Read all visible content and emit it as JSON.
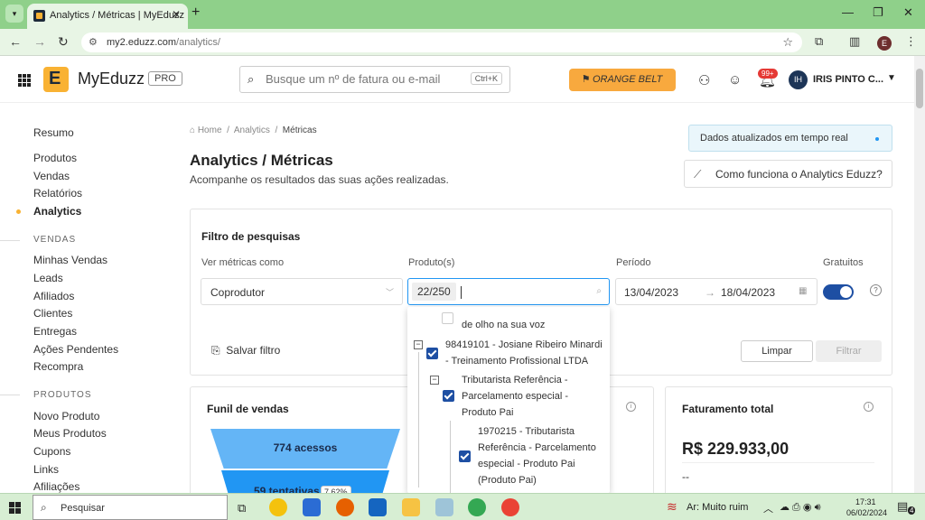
{
  "browser": {
    "tab_title": "Analytics / Métricas | MyEduzz",
    "url_host": "my2.eduzz.com",
    "url_path": "/analytics/",
    "profile_letter": "E"
  },
  "header": {
    "brand": "MyEduzz",
    "plan": "PRO",
    "search_placeholder": "Busque um nº de fatura ou e-mail",
    "search_shortcut": "Ctrl+K",
    "belt_label": "ORANGE BELT",
    "notif_count": "99+",
    "user_initials": "IH",
    "user_name": "IRIS PINTO C..."
  },
  "sidebar": {
    "top_items": [
      {
        "label": "Resumo"
      },
      {
        "label": "Produtos"
      },
      {
        "label": "Vendas"
      },
      {
        "label": "Relatórios"
      },
      {
        "label": "Analytics"
      }
    ],
    "sales_title": "VENDAS",
    "sales_items": [
      {
        "label": "Minhas Vendas"
      },
      {
        "label": "Leads"
      },
      {
        "label": "Afiliados"
      },
      {
        "label": "Clientes"
      },
      {
        "label": "Entregas"
      },
      {
        "label": "Ações Pendentes"
      },
      {
        "label": "Recompra"
      }
    ],
    "products_title": "PRODUTOS",
    "products_items": [
      {
        "label": "Novo Produto"
      },
      {
        "label": "Meus Produtos"
      },
      {
        "label": "Cupons"
      },
      {
        "label": "Links"
      },
      {
        "label": "Afiliações"
      }
    ]
  },
  "main": {
    "breadcrumb": {
      "home": "Home",
      "sep": "/",
      "analytics": "Analytics",
      "current": "Métricas"
    },
    "title": "Analytics / Métricas",
    "subtitle": "Acompanhe os resultados das suas ações realizadas.",
    "realtime": "Dados atualizados em tempo real",
    "howto": "Como funciona o Analytics Eduzz?",
    "filter": {
      "title": "Filtro de pesquisas",
      "view_label": "Ver métricas como",
      "view_value": "Coprodutor",
      "product_label": "Produto(s)",
      "product_count": "22/250",
      "period_label": "Período",
      "date_from": "13/04/2023",
      "date_arrow": "→",
      "date_to": "18/04/2023",
      "free_label": "Gratuitos",
      "save_label": "Salvar filtro",
      "clear_label": "Limpar",
      "apply_label": "Filtrar"
    },
    "dropdown": [
      {
        "text": "de olho na sua voz",
        "checked": false
      },
      {
        "text": "98419101 - Josiane Ribeiro Minardi - Treinamento Profissional LTDA",
        "checked": true
      },
      {
        "text": "Tributarista Referência - Parcelamento especial - Produto Pai",
        "checked": true
      },
      {
        "text": "1970215 - Tributarista Referência - Parcelamento especial - Produto Pai (Produto Pai)",
        "checked": true
      }
    ],
    "funnel": {
      "title": "Funil de vendas",
      "top_label": "774 acessos",
      "mid_label": "59 tentativas",
      "mid_pct": "7,62%"
    },
    "revenue": {
      "title": "Faturamento total",
      "value": "R$ 229.933,00",
      "sub": "--"
    }
  },
  "taskbar": {
    "search_label": "Pesquisar",
    "weather": "Ar: Muito ruim",
    "time": "17:31",
    "date": "06/02/2024",
    "notif": "4"
  },
  "colors": {
    "accent": "#f9b233",
    "primary": "#1e4fa3",
    "funnel_top": "#64b5f6",
    "funnel_mid": "#2196f3",
    "belt": "#f8a93e",
    "chrome": "#8fd08a"
  }
}
